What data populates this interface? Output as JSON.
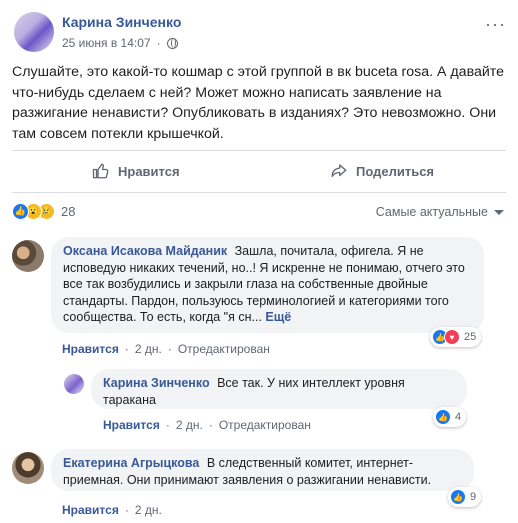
{
  "post": {
    "author": "Карина Зинченко",
    "timestamp": "25 июня в 14:07",
    "privacy_icon": "globe-icon",
    "more_label": "···",
    "text": "Слушайте, это какой-то кошмар с этой группой в вк buceta rosa. А давайте что-нибудь сделаем с ней? Может можно написать заявление на разжигание ненависти? Опубликовать в изданиях? Это невозможно. Они там совсем потекли крышечкой.",
    "actions": {
      "like": "Нравится",
      "share": "Поделиться"
    },
    "reactions_count": "28",
    "sort_label": "Самые актуальные"
  },
  "comments": [
    {
      "author": "Оксана Исакова Майданик",
      "text": "Зашла, почитала, офигела. Я не исповедую никаких течений, но..! Я искренне не понимаю, отчего это все так возбудились и закрыли глаза на собственные двойные стандарты. Пардон, пользуюсь терминологией и категориями того сообщества. То есть, когда \"я сн...",
      "see_more": "Ещё",
      "like": "Нравится",
      "reply": "Ответить",
      "time": "2 дн.",
      "edited": "Отредактирован",
      "reactions": "25"
    },
    {
      "author": "Карина Зинченко",
      "text": "Все так. У них интеллект уровня таракана",
      "like": "Нравится",
      "time": "2 дн.",
      "edited": "Отредактирован",
      "reactions": "4"
    },
    {
      "author": "Екатерина Агрыцкова",
      "text": "В следственный комитет, интернет-приемная. Они принимают заявления о разжигании ненависти.",
      "like": "Нравится",
      "time": "2 дн.",
      "reactions": "9"
    }
  ],
  "sep": "·",
  "colors": {
    "link": "#385898",
    "like": "#1877f2",
    "love": "#f33e58",
    "bubble": "#f2f3f5"
  }
}
